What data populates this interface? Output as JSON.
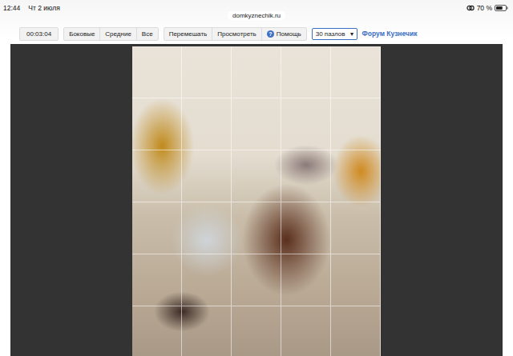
{
  "status_bar": {
    "time": "12:44",
    "date": "Чт 2 июля",
    "url": "domkyznechik.ru",
    "battery": "70 %",
    "battery_level": 0.7
  },
  "toolbar": {
    "timer": "00:03:04",
    "filter_buttons": [
      {
        "label": "Боковые"
      },
      {
        "label": "Средние"
      },
      {
        "label": "Все"
      }
    ],
    "action_buttons": [
      {
        "label": "Перемешать",
        "icon": ""
      },
      {
        "label": "Просмотреть",
        "icon": ""
      },
      {
        "label": "Помощь",
        "icon": "?"
      }
    ],
    "select": {
      "value": "30 пазлов",
      "arrow": "▾"
    },
    "forum_link": "Форум Кузнечик"
  },
  "puzzle": {
    "columns": 5,
    "rows": 6
  }
}
